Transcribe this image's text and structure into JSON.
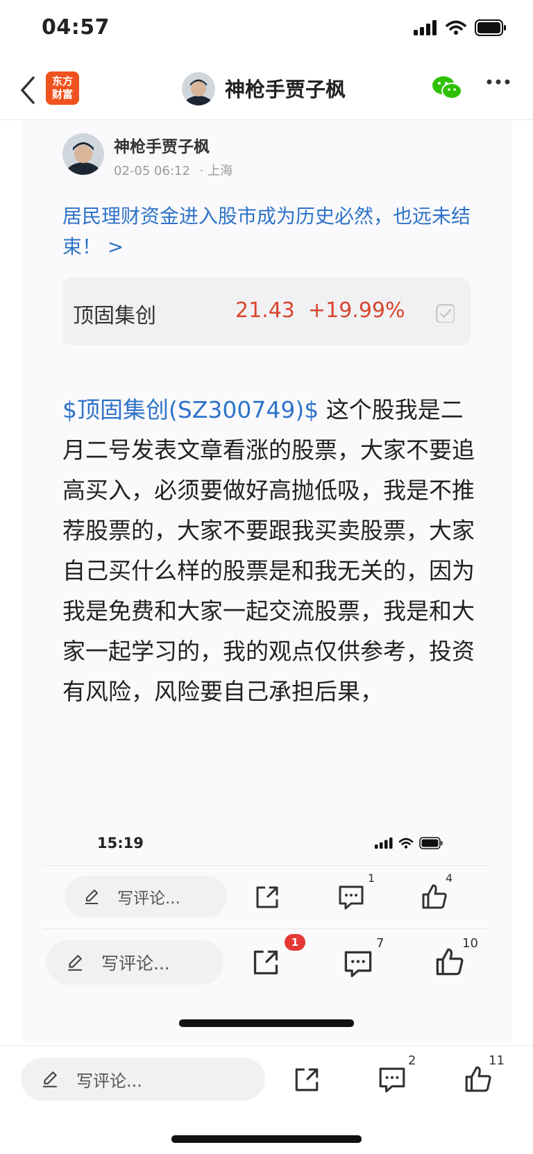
{
  "status_bar": {
    "time": "04:57"
  },
  "nav": {
    "logo_line1": "东方",
    "logo_line2": "财富",
    "title": "神枪手贾子枫"
  },
  "post": {
    "author": "神枪手贾子枫",
    "time": "02-05 06:12",
    "location": "· 上海",
    "headline": "居民理财资金进入股市成为历史必然，也远未结束！ >",
    "stock": {
      "name": "顶固集创",
      "price": "21.43",
      "change": "+19.99%"
    },
    "body_link": "$顶固集创(SZ300749)$",
    "body": " 这个股我是二月二号发表文章看涨的股票，大家不要追高买入，必须要做好高抛低吸，我是不推荐股票的，大家不要跟我买卖股票，大家自己买什么样的股票是和我无关的，因为我是免费和大家一起交流股票，我是和大家一起学习的，我的观点仅供参考，投资有风险，风险要自己承担后果，"
  },
  "inner_status": {
    "time": "15:19"
  },
  "bars": [
    {
      "comment_placeholder": "写评论...",
      "comment_count": "1",
      "like_count": "4"
    },
    {
      "comment_placeholder": "写评论...",
      "share_badge": "1",
      "comment_count": "7",
      "like_count": "10"
    },
    {
      "comment_placeholder": "写评论...",
      "comment_count": "2",
      "like_count": "11"
    }
  ],
  "colors": {
    "accent_blue": "#2f73c8",
    "up_red": "#d9452c",
    "brand_orange": "#f0521f",
    "wechat_green": "#2dc100"
  },
  "icons": [
    "back-chevron-icon",
    "wechat-icon",
    "more-icon",
    "pencil-icon",
    "share-icon",
    "comment-icon",
    "like-icon",
    "signal-icon",
    "wifi-icon",
    "battery-icon"
  ]
}
